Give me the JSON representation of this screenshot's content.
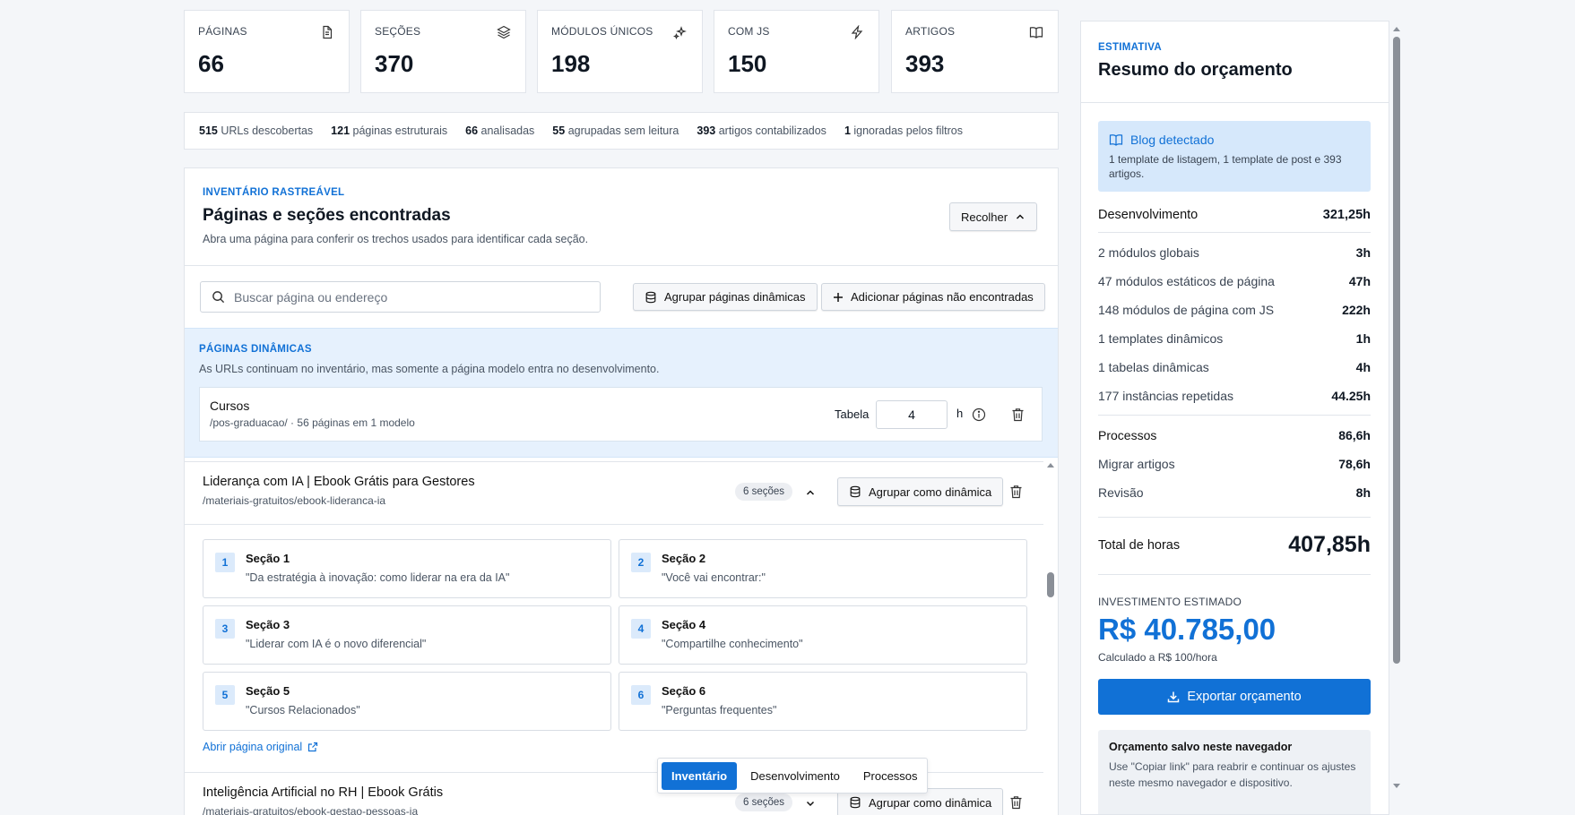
{
  "stats": [
    {
      "label": "PÁGINAS",
      "value": "66",
      "icon": "document-icon"
    },
    {
      "label": "SEÇÕES",
      "value": "370",
      "icon": "layers-icon"
    },
    {
      "label": "MÓDULOS ÚNICOS",
      "value": "198",
      "icon": "sparkles-icon"
    },
    {
      "label": "COM JS",
      "value": "150",
      "icon": "lightning-icon"
    },
    {
      "label": "ARTIGOS",
      "value": "393",
      "icon": "book-icon"
    }
  ],
  "summary": [
    {
      "n": "515",
      "t": "URLs descobertas"
    },
    {
      "n": "121",
      "t": "páginas estruturais"
    },
    {
      "n": "66",
      "t": "analisadas"
    },
    {
      "n": "55",
      "t": "agrupadas sem leitura"
    },
    {
      "n": "393",
      "t": "artigos contabilizados"
    },
    {
      "n": "1",
      "t": "ignoradas pelos filtros"
    }
  ],
  "inventory": {
    "eyebrow": "INVENTÁRIO RASTREÁVEL",
    "title": "Páginas e seções encontradas",
    "subtitle": "Abra uma página para conferir os trechos usados para identificar cada seção.",
    "collapse_label": "Recolher",
    "search_placeholder": "Buscar página ou endereço",
    "group_dynamic_label": "Agrupar páginas dinâmicas",
    "add_pages_label": "Adicionar páginas não encontradas"
  },
  "dynamic": {
    "eyebrow": "PÁGINAS DINÂMICAS",
    "description": "As URLs continuam no inventário, mas somente a página modelo entra no desenvolvimento.",
    "item": {
      "name": "Cursos",
      "meta": "/pos-graduacao/ · 56 páginas em 1 modelo",
      "type_label": "Tabela",
      "hours": "4",
      "unit": "h"
    }
  },
  "pages": [
    {
      "title": "Liderança com IA | Ebook Grátis para Gestores",
      "path": "/materiais-gratuitos/ebook-lideranca-ia",
      "sections_badge": "6 seções",
      "group_label": "Agrupar como dinâmica",
      "sections": [
        {
          "num": "1",
          "title": "Seção 1",
          "quote": "\"Da estratégia à inovação: como liderar na era da IA\""
        },
        {
          "num": "2",
          "title": "Seção 2",
          "quote": "\"Você vai encontrar:\""
        },
        {
          "num": "3",
          "title": "Seção 3",
          "quote": "\"Liderar com IA é o novo diferencial\""
        },
        {
          "num": "4",
          "title": "Seção 4",
          "quote": "\"Compartilhe conhecimento\""
        },
        {
          "num": "5",
          "title": "Seção 5",
          "quote": "\"Cursos Relacionados\""
        },
        {
          "num": "6",
          "title": "Seção 6",
          "quote": "\"Perguntas frequentes\""
        }
      ],
      "open_label": "Abrir página original"
    },
    {
      "title": "Inteligência Artificial no RH | Ebook Grátis",
      "path": "/materiais-gratuitos/ebook-gestao-pessoas-ia",
      "sections_badge": "6 seções",
      "group_label": "Agrupar como dinâmica"
    }
  ],
  "tabs": [
    "Inventário",
    "Desenvolvimento",
    "Processos"
  ],
  "budget": {
    "eyebrow": "ESTIMATIVA",
    "title": "Resumo do orçamento",
    "blog_title": "Blog detectado",
    "blog_text": "1 template de listagem, 1 template de post e 393 artigos.",
    "dev_label": "Desenvolvimento",
    "dev_value": "321,25h",
    "dev_items": [
      {
        "label": "2 módulos globais",
        "value": "3h"
      },
      {
        "label": "47 módulos estáticos de página",
        "value": "47h"
      },
      {
        "label": "148 módulos de página com JS",
        "value": "222h"
      },
      {
        "label": "1 templates dinâmicos",
        "value": "1h"
      },
      {
        "label": "1 tabelas dinâmicas",
        "value": "4h"
      },
      {
        "label": "177 instâncias repetidas",
        "value": "44.25h"
      }
    ],
    "proc_items": [
      {
        "label": "Processos",
        "value": "86,6h"
      },
      {
        "label": "Migrar artigos",
        "value": "78,6h"
      },
      {
        "label": "Revisão",
        "value": "8h"
      }
    ],
    "total_label": "Total de horas",
    "total_value": "407,85h",
    "invest_label": "INVESTIMENTO ESTIMADO",
    "invest_value": "R$ 40.785,00",
    "invest_note": "Calculado a R$ 100/hora",
    "export_label": "Exportar orçamento",
    "saved_title": "Orçamento salvo neste navegador",
    "saved_text": "Use \"Copiar link\" para reabrir e continuar os ajustes neste mesmo navegador e dispositivo."
  }
}
